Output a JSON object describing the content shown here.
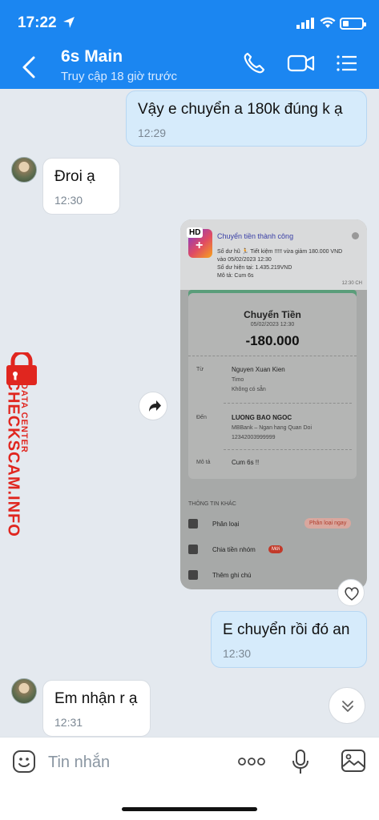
{
  "status_bar": {
    "time": "17:22"
  },
  "header": {
    "title": "6s Main",
    "subtitle": "Truy cập 18 giờ trước",
    "icons": [
      "back-icon",
      "phone-icon",
      "video-call-icon",
      "menu-icon"
    ]
  },
  "messages": [
    {
      "id": "m1",
      "direction": "out",
      "text": "Vậy e chuyển a 180k đúng k ạ",
      "time": "12:29"
    },
    {
      "id": "m2",
      "direction": "in",
      "text": "Đroi ạ",
      "time": "12:30"
    },
    {
      "id": "m3",
      "direction": "out",
      "type": "image"
    },
    {
      "id": "m4",
      "direction": "out",
      "text": "E chuyển rồi đó an",
      "time": "12:30"
    },
    {
      "id": "m5",
      "direction": "in",
      "text": "Em nhận r ạ",
      "time": "12:31"
    }
  ],
  "receipt": {
    "notification": {
      "badge": "HD",
      "title": "Chuyển tiền thành công",
      "line1": "Số dư hũ 🏃 Tiết kiệm !!!!! vừa giảm 180.000 VND",
      "line2": "vào 05/02/2023 12:30",
      "line3": "Số dư hiện tại: 1.435.219VND",
      "line4": "Mô tả: Cum 6s",
      "time": "12:30 CH"
    },
    "title": "Chuyển Tiền",
    "date": "05/02/2023 12:30",
    "amount": "-180.000",
    "from_label": "Từ",
    "from_name": "Nguyen Xuan Kien",
    "from_bank": "Timo",
    "from_account": "Không có sẵn",
    "to_label": "Đến",
    "to_name": "LUONG BAO NGOC",
    "to_bank": "MBBank – Ngan hang Quan Doi",
    "to_account": "12342003999999",
    "desc_label": "Mô tả",
    "desc_value": "Cum 6s !!",
    "other_title": "THÔNG TIN KHÁC",
    "row_category": "Phân loại",
    "row_category_tag": "Phân loại ngay",
    "row_split": "Chia tiền nhóm",
    "row_split_tag": "Mới",
    "row_note": "Thêm ghi chú"
  },
  "watermark": {
    "main": "CHECKSCAM.INFO",
    "sub": "DATA CENTER"
  },
  "input": {
    "placeholder": "Tin nhắn"
  },
  "colors": {
    "header": "#1b86f1",
    "out_bubble": "#d6ebfb",
    "in_bubble": "#ffffff",
    "watermark": "#e0261f"
  }
}
